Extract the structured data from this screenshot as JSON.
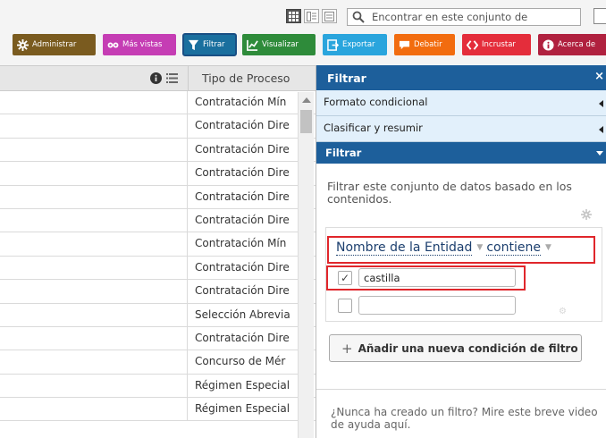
{
  "toolbar": {
    "view_icons": [
      "grid-view-icon",
      "card-view-icon",
      "list-view-icon"
    ],
    "search": {
      "placeholder": "Encontrar en este conjunto de",
      "value": ""
    },
    "buttons": [
      {
        "label": "Administrar",
        "icon": "gear-icon",
        "color": "#7a5b1f"
      },
      {
        "label": "Más vistas",
        "icon": "glasses-icon",
        "color": "#c53db4"
      },
      {
        "label": "Filtrar",
        "icon": "funnel-icon",
        "color": "#1a6f9e"
      },
      {
        "label": "Visualizar",
        "icon": "chart-icon",
        "color": "#2e8b3a"
      },
      {
        "label": "Exportar",
        "icon": "export-icon",
        "color": "#2aa5dd"
      },
      {
        "label": "Debatir",
        "icon": "speech-bubble-icon",
        "color": "#f26c0f"
      },
      {
        "label": "Incrustar",
        "icon": "code-icon",
        "color": "#e42d3b"
      },
      {
        "label": "Acerca de",
        "icon": "info-icon",
        "color": "#b0213f"
      }
    ]
  },
  "table": {
    "column": "Tipo de Proceso",
    "rows": [
      "Contratación Mín",
      "Contratación Dire",
      "Contratación Dire",
      "Contratación Dire",
      "Contratación Dire",
      "Contratación Dire",
      "Contratación Mín",
      "Contratación Dire",
      "Contratación Dire",
      "Selección Abrevia",
      "Contratación Dire",
      "Concurso de Mér",
      "Régimen Especial",
      "Régimen Especial"
    ]
  },
  "panel": {
    "title": "Filtrar",
    "close": "×",
    "sections": [
      {
        "label": "Formato condicional"
      },
      {
        "label": "Clasificar y resumir"
      }
    ],
    "active_section": "Filtrar",
    "description": "Filtrar este conjunto de datos basado en los contenidos.",
    "filter": {
      "column": "Nombre de la Entidad",
      "operator": "contiene",
      "conditions": [
        {
          "checked": true,
          "value": "castilla"
        },
        {
          "checked": false,
          "value": ""
        }
      ]
    },
    "add_button": "Añadir una nueva condición de filtro",
    "help": "¿Nunca ha creado un filtro? Mire este breve video de ayuda aquí."
  }
}
